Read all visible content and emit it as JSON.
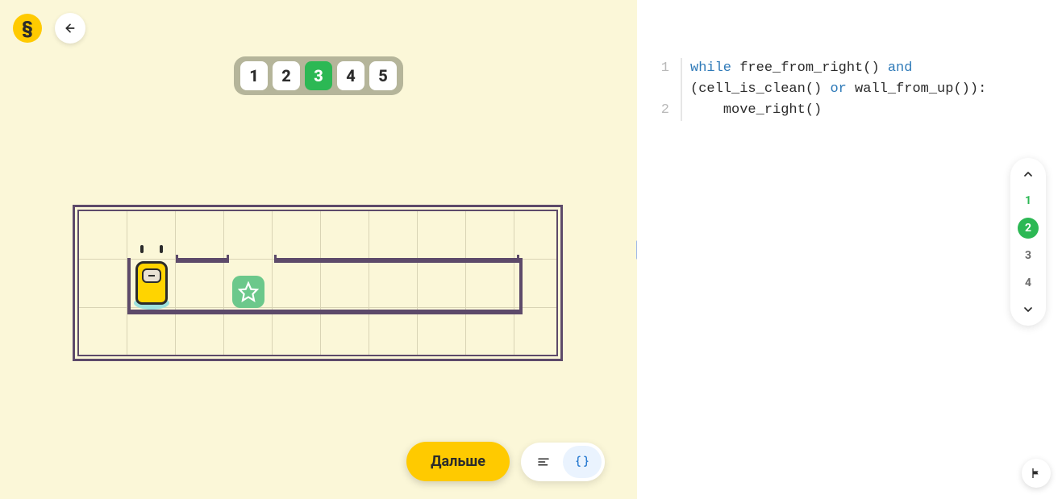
{
  "header": {
    "logo_char": "§"
  },
  "levels": {
    "items": [
      "1",
      "2",
      "3",
      "4",
      "5"
    ],
    "active_index": 2
  },
  "actions": {
    "next_label": "Дальше"
  },
  "code": {
    "lines": [
      {
        "n": "1",
        "segments": [
          {
            "t": "while",
            "c": "kw"
          },
          {
            "t": " free_from_right() "
          },
          {
            "t": "and",
            "c": "tok-and"
          },
          {
            "t": " (cell_is_clean() "
          },
          {
            "t": "or",
            "c": "tok-or"
          },
          {
            "t": " wall_from_up()):"
          }
        ]
      },
      {
        "n": "2",
        "segments": [
          {
            "t": "    move_right()"
          }
        ]
      }
    ]
  },
  "steps": {
    "items": [
      "1",
      "2",
      "3",
      "4"
    ],
    "done_index": 0,
    "current_index": 1
  }
}
